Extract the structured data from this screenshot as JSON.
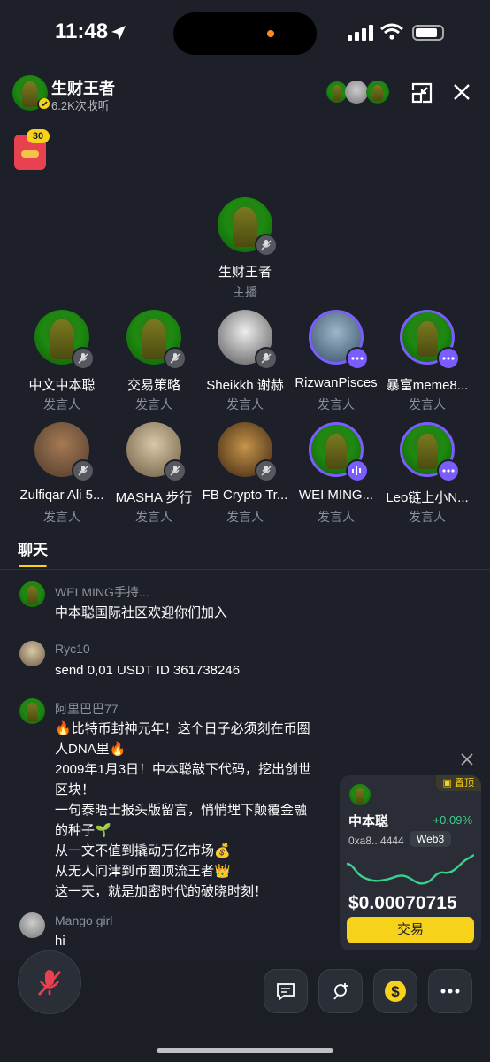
{
  "status": {
    "time": "11:48"
  },
  "header": {
    "host_name": "生财王者",
    "listeners": "6.2K次收听"
  },
  "gift": {
    "count": "30"
  },
  "host": {
    "name": "生财王者",
    "role": "主播"
  },
  "speakers_row1": [
    {
      "name": "中文中本聪",
      "role": "发言人"
    },
    {
      "name": "交易策略",
      "role": "发言人"
    },
    {
      "name": "Sheikkh 谢赫",
      "role": "发言人"
    },
    {
      "name": "RizwanPisces",
      "role": "发言人"
    },
    {
      "name": "暴富meme8...",
      "role": "发言人"
    }
  ],
  "speakers_row2": [
    {
      "name": "Zulfiqar Ali 5...",
      "role": "发言人"
    },
    {
      "name": "MASHA 步行",
      "role": "发言人"
    },
    {
      "name": "FB Crypto Tr...",
      "role": "发言人"
    },
    {
      "name": "WEI MING...",
      "role": "发言人"
    },
    {
      "name": "Leo链上小N...",
      "role": "发言人"
    }
  ],
  "tabs": {
    "chat": "聊天"
  },
  "chat": [
    {
      "user": "WEI MING手持...",
      "lines": [
        "中本聪国际社区欢迎你们加入"
      ]
    },
    {
      "user": "Ryc10",
      "lines": [
        "send 0,01 USDT ID 361738246"
      ]
    },
    {
      "user": "阿里巴巴77",
      "lines": [
        "🔥比特币封神元年！这个日子必须刻在币圈",
        "人DNA里🔥",
        "2009年1月3日！中本聪敲下代码，挖出创世",
        "区块！",
        "一句泰晤士报头版留言，悄悄埋下颠覆金融",
        "的种子🌱",
        "从一文不值到撬动万亿市场💰",
        "从无人问津到币圈顶流王者👑",
        "这一天，就是加密时代的破晓时刻！"
      ]
    },
    {
      "user": "Mango girl",
      "lines": [
        "hi"
      ]
    }
  ],
  "token_card": {
    "pinned": "置顶",
    "name": "中本聪",
    "change": "+0.09%",
    "address": "0xa8...4444",
    "tag": "Web3",
    "price": "$0.00070715",
    "trade": "交易"
  },
  "colors": {
    "accent": "#f7d21b",
    "positive": "#3ad18e",
    "ring": "#7a5cff",
    "bg": "#1d2029"
  }
}
